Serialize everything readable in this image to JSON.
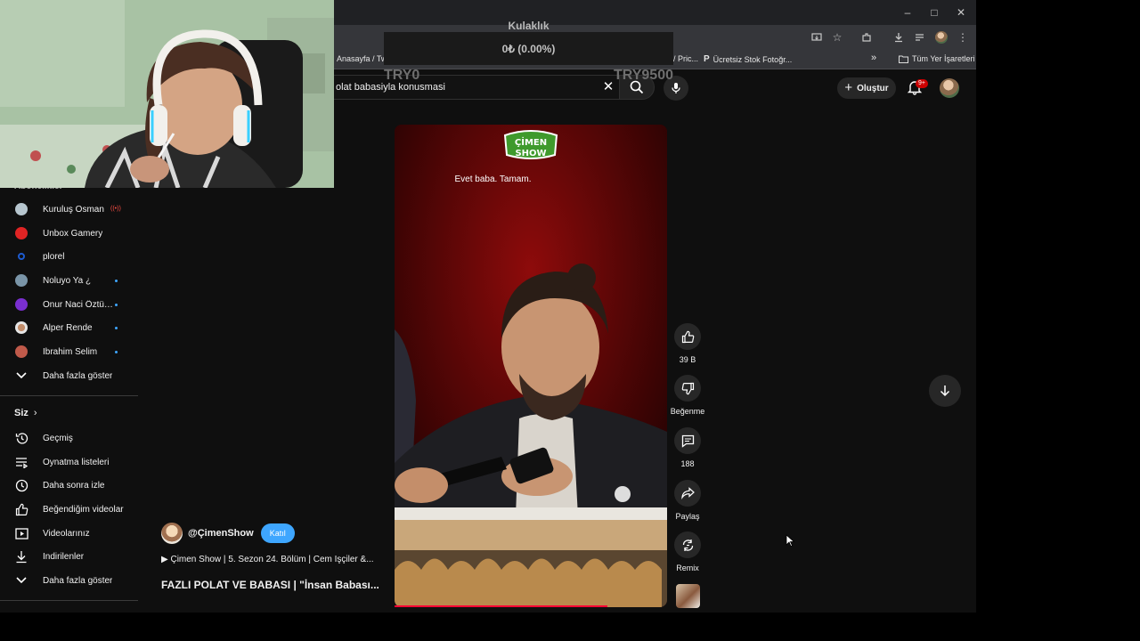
{
  "browser": {
    "window_controls": {
      "minimize": "–",
      "maximize": "□",
      "close": "✕"
    },
    "bookmarks": [
      {
        "label": "Anasayfa / Tw",
        "icon": "page-icon"
      },
      {
        "label": "/ Pric...",
        "icon": "page-icon"
      },
      {
        "label": "Ücretsiz Stok Fotoğr...",
        "icon": "p-logo-icon"
      }
    ],
    "bookmarks_overflow": "»",
    "all_bookmarks": "Tüm Yer İşaretleri"
  },
  "youtube": {
    "search": {
      "value": "olat babasiyla konusmasi",
      "clear": "✕"
    },
    "create_label": "Oluştur",
    "notification_count": "9+"
  },
  "sidebar": {
    "subscriptions_partial_header": "Abonelikler",
    "subscriptions": [
      {
        "label": "Kuruluş Osman",
        "avatar_color": "#b7c6cf",
        "status": "live"
      },
      {
        "label": "Unbox Gamery",
        "avatar_color": "#e02424",
        "status": ""
      },
      {
        "label": "plorel",
        "avatar_color": "#1d3b8f",
        "status": ""
      },
      {
        "label": "Noluyo Ya ¿",
        "avatar_color": "#7a95a8",
        "status": "new"
      },
      {
        "label": "Onur Naci Öztürk...",
        "avatar_color": "#7a2fd0",
        "status": "new"
      },
      {
        "label": "Alper Rende",
        "avatar_color": "#d0d0d0",
        "status": "new"
      },
      {
        "label": "İbrahim Selim",
        "avatar_color": "#c05a4a",
        "status": "new"
      }
    ],
    "show_more_1": "Daha fazla göster",
    "you_header": "Siz",
    "you_items": [
      {
        "label": "Geçmiş",
        "icon": "history-icon"
      },
      {
        "label": "Oynatma listeleri",
        "icon": "playlists-icon"
      },
      {
        "label": "Daha sonra izle",
        "icon": "clock-icon"
      },
      {
        "label": "Beğendiğim videolar",
        "icon": "thumbs-up-icon"
      },
      {
        "label": "Videolarınız",
        "icon": "your-videos-icon"
      },
      {
        "label": "İndirilenler",
        "icon": "download-icon"
      }
    ],
    "show_more_2": "Daha fazla göster"
  },
  "short": {
    "caption": "Evet baba. Tamam.",
    "logo_text": "ÇİMEN SHOW",
    "progress_fraction": 0.78,
    "channel": "@ÇimenShow",
    "join_label": "Katıl",
    "playlist_line": "▶ Çimen Show | 5. Sezon 24. Bölüm | Cem İşçiler &...",
    "title": "FAZLI POLAT VE BABASI | \"İnsan Babası...",
    "actions": {
      "like_count": "39 B",
      "dislike_label": "Beğenme",
      "comment_count": "188",
      "share_label": "Paylaş",
      "remix_label": "Remix"
    }
  },
  "overlay": {
    "donation_title": "Kulaklık",
    "donation_amount": "0₺ (0.00%)",
    "donation_min": "TRY0",
    "donation_max": "TRY9500",
    "donation_progress_fraction": 0.0
  }
}
